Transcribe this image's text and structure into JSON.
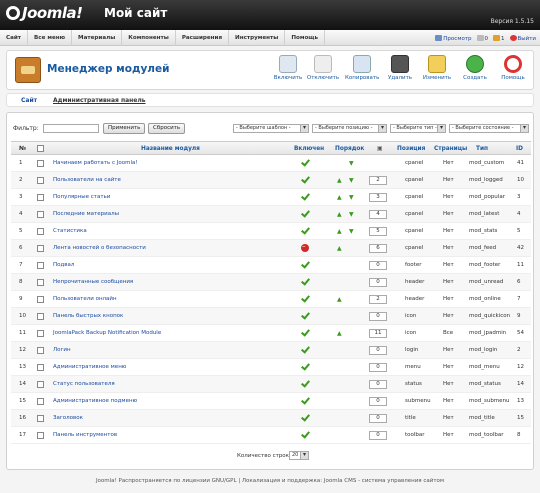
{
  "header": {
    "logo": "Joomla!",
    "site_title": "Мой сайт",
    "version": "Версия 1.5.15"
  },
  "menu": [
    "Сайт",
    "Все меню",
    "Материалы",
    "Компоненты",
    "Расширения",
    "Инструменты",
    "Помощь"
  ],
  "status": {
    "preview": "Просмотр",
    "messages": "0",
    "users": "1",
    "logout": "Выйти"
  },
  "toolbar": {
    "title": "Менеджер модулей",
    "buttons": [
      "Включить",
      "Отключить",
      "Копировать",
      "Удалить",
      "Изменить",
      "Создать",
      "Помощь"
    ]
  },
  "subnav": {
    "site": "Сайт",
    "admin": "Административная панель"
  },
  "filter": {
    "label": "Фильтр:",
    "apply": "Применить",
    "reset": "Сбросить",
    "selects": [
      "- Выберите шаблон -",
      "- Выберите позицию -",
      "- Выберите тип -",
      "- Выберите состояние -"
    ]
  },
  "table": {
    "headers": [
      "№",
      "Название модуля",
      "Включен",
      "Порядок",
      "Позиция",
      "Страницы",
      "Тип",
      "ID"
    ],
    "rows": [
      {
        "n": "1",
        "name": "Начинаем работать с Joomla!",
        "enabled": true,
        "order": "",
        "pos": "cpanel",
        "pages": "Нет",
        "type": "mod_custom",
        "id": "41"
      },
      {
        "n": "2",
        "name": "Пользователи на сайте",
        "enabled": true,
        "order": "2",
        "pos": "cpanel",
        "pages": "Нет",
        "type": "mod_logged",
        "id": "10"
      },
      {
        "n": "3",
        "name": "Популярные статьи",
        "enabled": true,
        "order": "3",
        "pos": "cpanel",
        "pages": "Нет",
        "type": "mod_popular",
        "id": "3"
      },
      {
        "n": "4",
        "name": "Последние материалы",
        "enabled": true,
        "order": "4",
        "pos": "cpanel",
        "pages": "Нет",
        "type": "mod_latest",
        "id": "4"
      },
      {
        "n": "5",
        "name": "Статистика",
        "enabled": true,
        "order": "5",
        "pos": "cpanel",
        "pages": "Нет",
        "type": "mod_stats",
        "id": "5"
      },
      {
        "n": "6",
        "name": "Лента новостей о безопасности",
        "enabled": false,
        "order": "6",
        "pos": "cpanel",
        "pages": "Нет",
        "type": "mod_feed",
        "id": "42"
      },
      {
        "n": "7",
        "name": "Подвал",
        "enabled": true,
        "order": "0",
        "pos": "footer",
        "pages": "Нет",
        "type": "mod_footer",
        "id": "11"
      },
      {
        "n": "8",
        "name": "Непрочитанные сообщения",
        "enabled": true,
        "order": "0",
        "pos": "header",
        "pages": "Нет",
        "type": "mod_unread",
        "id": "6"
      },
      {
        "n": "9",
        "name": "Пользователи онлайн",
        "enabled": true,
        "order": "2",
        "pos": "header",
        "pages": "Нет",
        "type": "mod_online",
        "id": "7"
      },
      {
        "n": "10",
        "name": "Панель быстрых кнопок",
        "enabled": true,
        "order": "0",
        "pos": "icon",
        "pages": "Нет",
        "type": "mod_quickicon",
        "id": "9"
      },
      {
        "n": "11",
        "name": "JoomlaPack Backup Notification Module",
        "enabled": true,
        "order": "11",
        "pos": "icon",
        "pages": "Все",
        "type": "mod_jpadmin",
        "id": "54"
      },
      {
        "n": "12",
        "name": "Логин",
        "enabled": true,
        "order": "0",
        "pos": "login",
        "pages": "Нет",
        "type": "mod_login",
        "id": "2"
      },
      {
        "n": "13",
        "name": "Административное меню",
        "enabled": true,
        "order": "0",
        "pos": "menu",
        "pages": "Нет",
        "type": "mod_menu",
        "id": "12"
      },
      {
        "n": "14",
        "name": "Статус пользователя",
        "enabled": true,
        "order": "0",
        "pos": "status",
        "pages": "Нет",
        "type": "mod_status",
        "id": "14"
      },
      {
        "n": "15",
        "name": "Административное подменю",
        "enabled": true,
        "order": "0",
        "pos": "submenu",
        "pages": "Нет",
        "type": "mod_submenu",
        "id": "13"
      },
      {
        "n": "16",
        "name": "Заголовок",
        "enabled": true,
        "order": "0",
        "pos": "title",
        "pages": "Нет",
        "type": "mod_title",
        "id": "15"
      },
      {
        "n": "17",
        "name": "Панель инструментов",
        "enabled": true,
        "order": "0",
        "pos": "toolbar",
        "pages": "Нет",
        "type": "mod_toolbar",
        "id": "8"
      }
    ]
  },
  "pager": {
    "label": "Количество строк:",
    "value": "20"
  },
  "footer": {
    "text": "Joomla! Распространяется по лицензии GNU/GPL | Локализация и поддержка: Joomla CMS - система управления сайтом"
  },
  "colors": {
    "accent": "#1a5aa0",
    "enabled": "#3a9b1c",
    "disabled": "#d42828"
  }
}
